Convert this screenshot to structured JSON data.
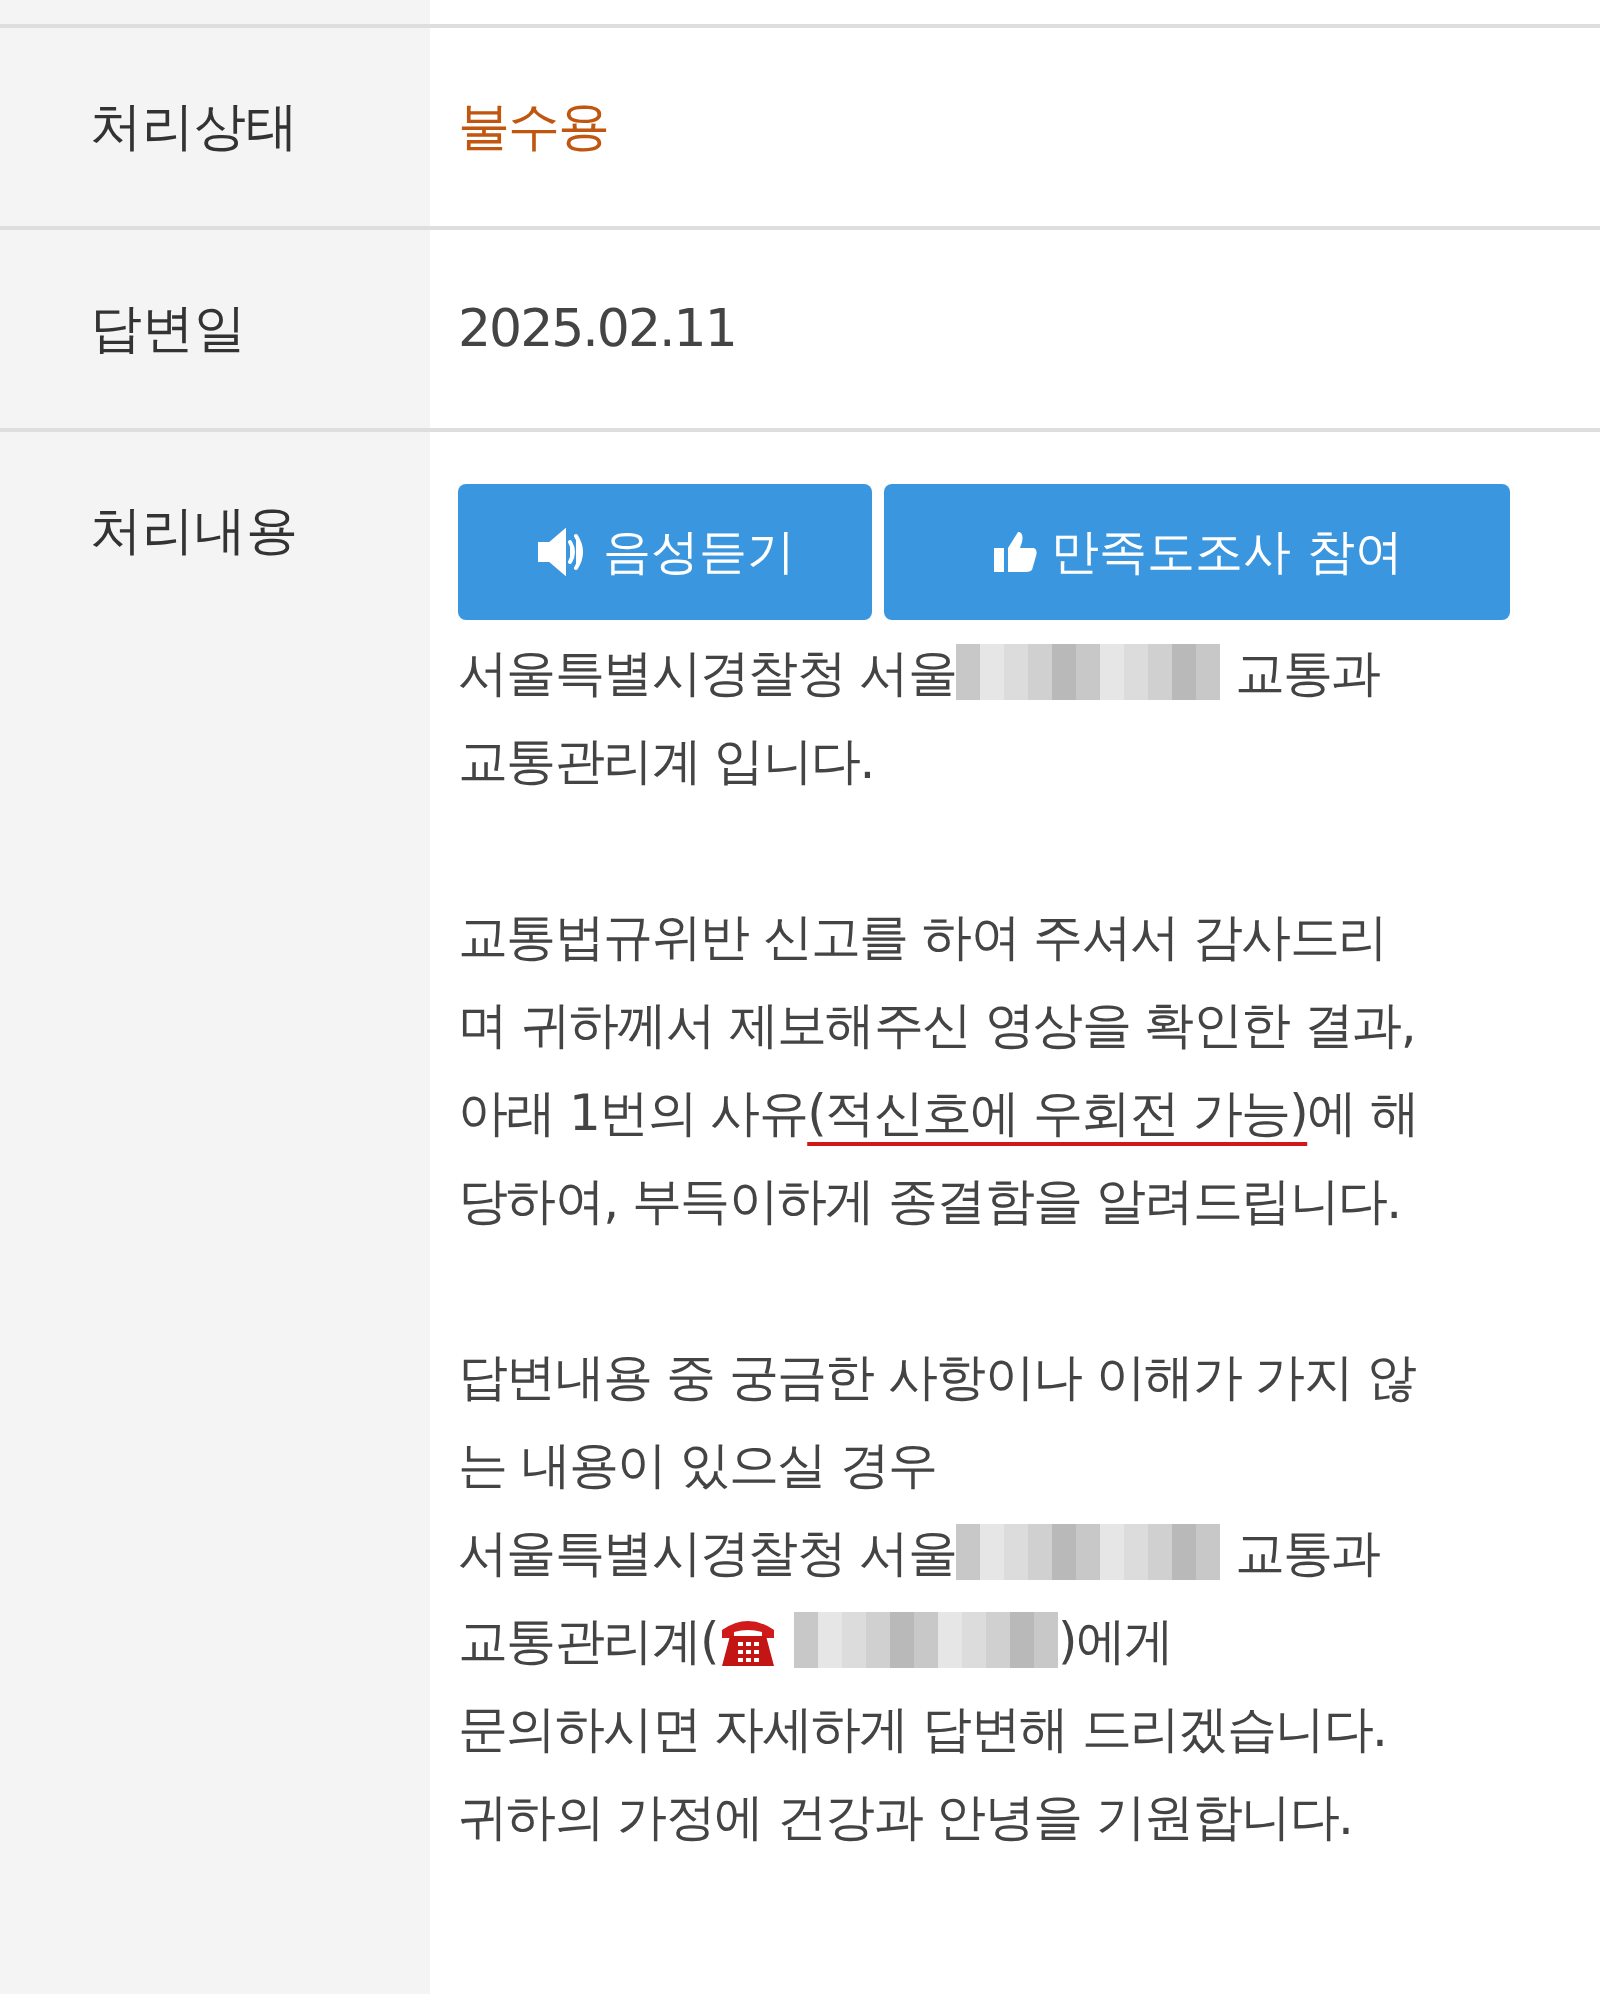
{
  "rows": [
    {
      "label": "처리상태",
      "kind": "status",
      "value": "불수용"
    },
    {
      "label": "답변일",
      "kind": "text",
      "value": "2025.02.11"
    },
    {
      "label": "처리내용",
      "kind": "content"
    }
  ],
  "buttons": [
    {
      "label": "음성듣기",
      "kind": "speaker"
    },
    {
      "label": "만족도조사 참여",
      "kind": "thumb"
    }
  ],
  "paragraphs": [
    [
      [
        {
          "kind": "text",
          "text": "서울특별시경찰청 서울"
        },
        {
          "kind": "redacted"
        },
        {
          "kind": "text",
          "text": " 교통과"
        }
      ],
      [
        {
          "kind": "text",
          "text": "교통관리계 입니다."
        }
      ]
    ],
    [
      [
        {
          "kind": "text",
          "text": "교통법규위반 신고를 하여 주셔서 감사드리"
        }
      ],
      [
        {
          "kind": "text",
          "text": "며 귀하께서 제보해주신 영상을 확인한 결과,"
        }
      ],
      [
        {
          "kind": "text",
          "text": "아래 1번의 사유"
        },
        {
          "kind": "underlined",
          "text": "(적신호에 우회전 가능)"
        },
        {
          "kind": "text",
          "text": "에 해"
        }
      ],
      [
        {
          "kind": "text",
          "text": "당하여, 부득이하게 종결함을 알려드립니다."
        }
      ]
    ],
    [
      [
        {
          "kind": "text",
          "text": "답변내용 중 궁금한 사항이나 이해가 가지 않"
        }
      ],
      [
        {
          "kind": "text",
          "text": "는 내용이 있으실 경우"
        }
      ],
      [
        {
          "kind": "text",
          "text": "서울특별시경찰청 서울"
        },
        {
          "kind": "redacted"
        },
        {
          "kind": "text",
          "text": " 교통과"
        }
      ],
      [
        {
          "kind": "text",
          "text": "교통관리계("
        },
        {
          "kind": "phone"
        },
        {
          "kind": "redacted"
        },
        {
          "kind": "text",
          "text": ")에게"
        }
      ],
      [
        {
          "kind": "text",
          "text": "문의하시면 자세하게 답변해 드리겠습니다."
        }
      ],
      [
        {
          "kind": "text",
          "text": "귀하의 가정에 건강과 안녕을 기원합니다."
        }
      ]
    ]
  ]
}
